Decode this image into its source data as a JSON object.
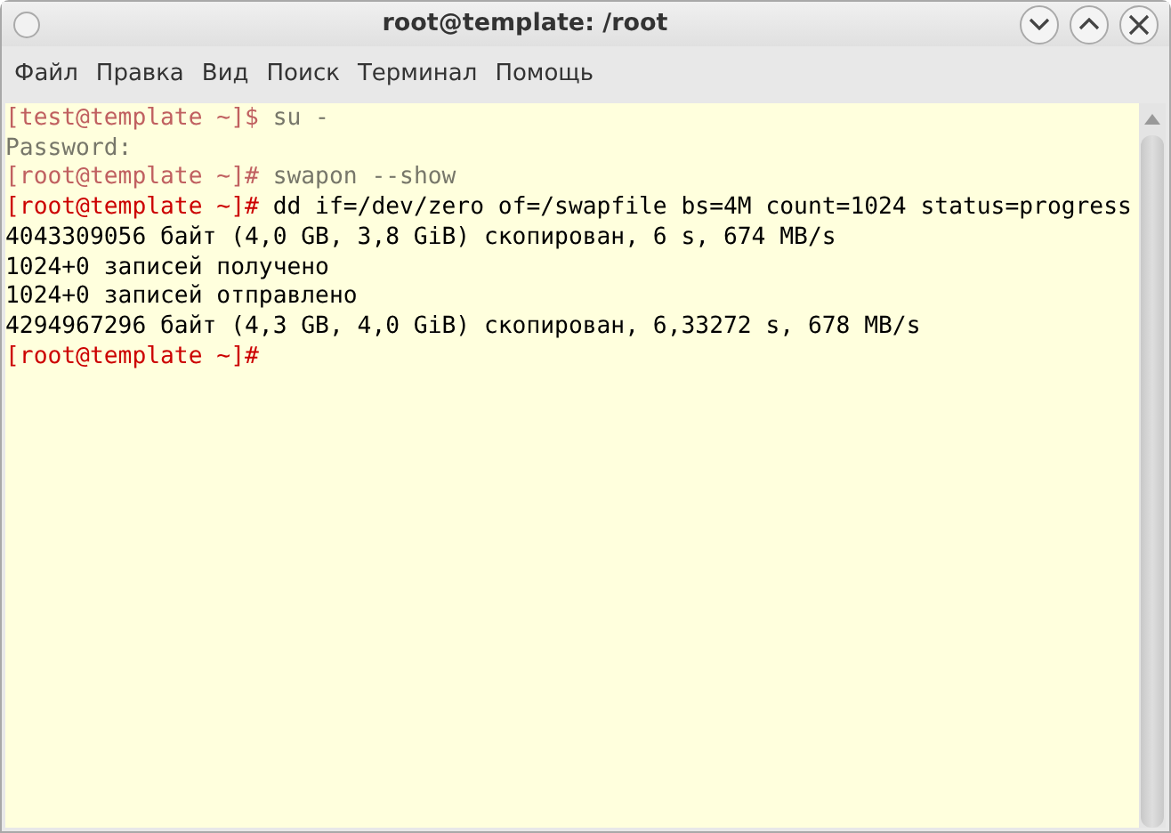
{
  "window": {
    "title": "root@template: /root"
  },
  "menu": [
    "Файл",
    "Правка",
    "Вид",
    "Поиск",
    "Терминал",
    "Помощь"
  ],
  "terminal": {
    "lines": [
      {
        "kind": "prompt",
        "prompt": "[test@template ~]$",
        "command": "su -",
        "blurred": true
      },
      {
        "kind": "output",
        "text": "Password:",
        "blurred": true
      },
      {
        "kind": "prompt",
        "prompt": "[root@template ~]#",
        "command": "swapon --show",
        "blurred": true
      },
      {
        "kind": "prompt",
        "prompt": "[root@template ~]#",
        "command": "dd if=/dev/zero of=/swapfile bs=4M count=1024 status=progress",
        "blurred": false
      },
      {
        "kind": "output",
        "text": "4043309056 байт (4,0 GB, 3,8 GiB) скопирован, 6 s, 674 MB/s",
        "blurred": false
      },
      {
        "kind": "output",
        "text": "1024+0 записей получено",
        "blurred": false
      },
      {
        "kind": "output",
        "text": "1024+0 записей отправлено",
        "blurred": false
      },
      {
        "kind": "output",
        "text": "4294967296 байт (4,3 GB, 4,0 GiB) скопирован, 6,33272 s, 678 MB/s",
        "blurred": false
      },
      {
        "kind": "prompt",
        "prompt": "[root@template ~]#",
        "blurred": false
      }
    ]
  }
}
